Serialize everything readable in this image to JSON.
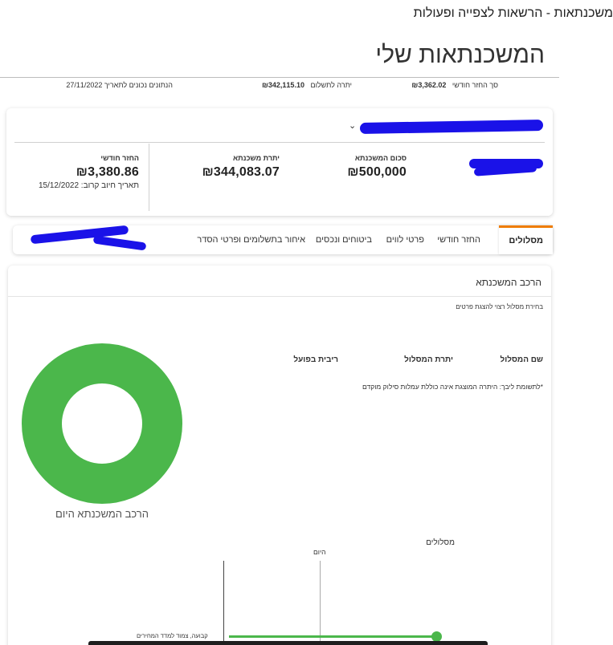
{
  "topbar": {
    "title": "משכנתאות - הרשאות לצפייה ופעולות"
  },
  "page": {
    "title": "המשכנתאות שלי"
  },
  "summary": {
    "monthly_label": "סך החזר חודשי",
    "monthly_value": "₪3,362.02",
    "balance_label": "יתרה לתשלום",
    "balance_value": "₪342,115.10",
    "date_note": "הנתונים נכונים לתאריך 27/11/2022"
  },
  "loan_card": {
    "stats": {
      "amount_label": "סכום המשכנתא",
      "amount_value": "₪500,000",
      "remaining_label": "יתרת משכנתא",
      "remaining_value": "₪344,083.07",
      "monthly_label": "החזר חודשי",
      "monthly_value": "₪3,380.86",
      "next_charge": "תאריך חיוב קרוב: 15/12/2022"
    }
  },
  "tabs": [
    {
      "label": "מסלולים",
      "active": true
    },
    {
      "label": "החזר חודשי",
      "active": false
    },
    {
      "label": "פרטי לווים",
      "active": false
    },
    {
      "label": "ביטוחים ונכסים",
      "active": false
    },
    {
      "label": "איחור בתשלומים ופרטי הסדר",
      "active": false
    }
  ],
  "composition": {
    "title": "הרכב המשכנתא",
    "hint": "בחירת מסלול רצוי להצגת פרטים",
    "columns": [
      "שם המסלול",
      "יתרת המסלול",
      "ריבית בפועל"
    ],
    "note": "*לתשומת ליבך: היתרה המוצגת אינה כוללת עמלות סילוק מוקדם",
    "donut_caption": "הרכב המשכנתא היום",
    "donut_color": "#4bb74b"
  },
  "tracks": {
    "title": "מסלולים",
    "today_label": "היום",
    "row_label": "קבועה, צמוד למדד המחירים",
    "bar_color": "#4bb74b"
  },
  "colors": {
    "accent": "#ef7c00",
    "redaction": "#1a12e8"
  }
}
